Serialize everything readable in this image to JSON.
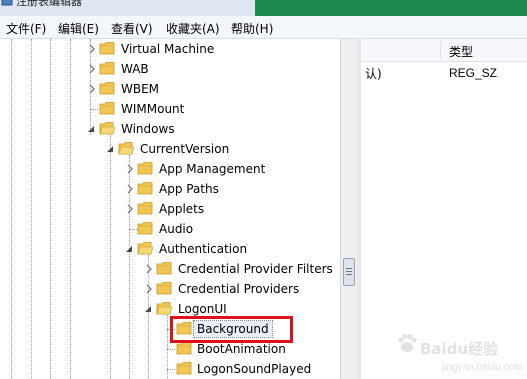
{
  "window": {
    "title": "注册表编辑器"
  },
  "menu": [
    {
      "label": "文件(F)"
    },
    {
      "label": "编辑(E)"
    },
    {
      "label": "查看(V)"
    },
    {
      "label": "收藏夹(A)"
    },
    {
      "label": "帮助(H)"
    }
  ],
  "tree": {
    "nodes": [
      {
        "label": "Virtual Machine",
        "expander": "collapsed"
      },
      {
        "label": "WAB",
        "expander": "collapsed"
      },
      {
        "label": "WBEM",
        "expander": "collapsed"
      },
      {
        "label": "WIMMount",
        "expander": "none"
      },
      {
        "label": "Windows",
        "expander": "expanded"
      },
      {
        "label": "CurrentVersion",
        "expander": "expanded"
      },
      {
        "label": "App Management",
        "expander": "collapsed"
      },
      {
        "label": "App Paths",
        "expander": "collapsed"
      },
      {
        "label": "Applets",
        "expander": "collapsed"
      },
      {
        "label": "Audio",
        "expander": "none"
      },
      {
        "label": "Authentication",
        "expander": "expanded"
      },
      {
        "label": "Credential Provider Filters",
        "expander": "collapsed"
      },
      {
        "label": "Credential Providers",
        "expander": "collapsed"
      },
      {
        "label": "LogonUI",
        "expander": "expanded"
      },
      {
        "label": "Background",
        "expander": "none",
        "selected": true
      },
      {
        "label": "BootAnimation",
        "expander": "none"
      },
      {
        "label": "LogonSoundPlayed",
        "expander": "none"
      }
    ]
  },
  "values_pane": {
    "column_type_header": "类型",
    "rows": [
      {
        "name_fragment": "认)",
        "type": "REG_SZ"
      }
    ]
  },
  "watermark": {
    "text": "Baidu经验",
    "sub": "jingyan.baidu.com"
  },
  "colors": {
    "highlight_border": "#e0101a",
    "folder": "#e8b73a",
    "titlebar_right": "#1f8a4e"
  }
}
